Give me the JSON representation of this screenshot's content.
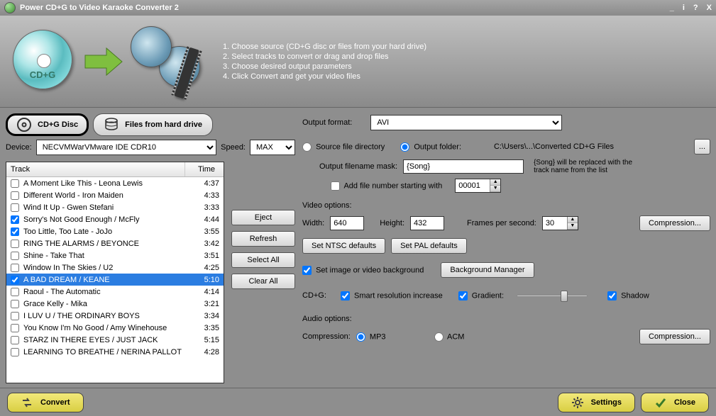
{
  "title": "Power CD+G to Video Karaoke Converter 2",
  "titlebar_icons": {
    "minimize": "_",
    "info": "i",
    "help": "?",
    "close": "X"
  },
  "disc_label": "CD+G",
  "instructions": [
    "1. Choose source (CD+G disc or files from your hard drive)",
    "2. Select tracks to convert or drag and drop files",
    "3. Choose desired output parameters",
    "4. Click Convert and get your video files"
  ],
  "source_buttons": {
    "disc": "CD+G Disc",
    "files": "Files from hard drive"
  },
  "device_label": "Device:",
  "device_value": "NECVMWarVMware IDE CDR10",
  "speed_label": "Speed:",
  "speed_value": "MAX",
  "columns": {
    "track": "Track",
    "time": "Time"
  },
  "tracks": [
    {
      "name": "A Moment Like This - Leona Lewis",
      "time": "4:37",
      "chk": false,
      "sel": false
    },
    {
      "name": "Different World - Iron Maiden",
      "time": "4:33",
      "chk": false,
      "sel": false
    },
    {
      "name": "Wind It Up - Gwen Stefani",
      "time": "3:33",
      "chk": false,
      "sel": false
    },
    {
      "name": "Sorry's Not Good Enough / McFly",
      "time": "4:44",
      "chk": true,
      "sel": false
    },
    {
      "name": "Too Little, Too Late - JoJo",
      "time": "3:55",
      "chk": true,
      "sel": false
    },
    {
      "name": "RING THE ALARMS / BEYONCE",
      "time": "3:42",
      "chk": false,
      "sel": false
    },
    {
      "name": "Shine - Take That",
      "time": "3:51",
      "chk": false,
      "sel": false
    },
    {
      "name": "Window In The Skies / U2",
      "time": "4:25",
      "chk": false,
      "sel": false
    },
    {
      "name": "A BAD DREAM / KEANE",
      "time": "5:10",
      "chk": true,
      "sel": true
    },
    {
      "name": "Raoul - The Automatic",
      "time": "4:14",
      "chk": false,
      "sel": false
    },
    {
      "name": "Grace Kelly - Mika",
      "time": "3:21",
      "chk": false,
      "sel": false
    },
    {
      "name": "I LUV U / THE ORDINARY BOYS",
      "time": "3:34",
      "chk": false,
      "sel": false
    },
    {
      "name": "You Know I'm No Good / Amy Winehouse",
      "time": "3:35",
      "chk": false,
      "sel": false
    },
    {
      "name": "STARZ IN THERE EYES / JUST JACK",
      "time": "5:15",
      "chk": false,
      "sel": false
    },
    {
      "name": "LEARNING TO BREATHE / NERINA PALLOT",
      "time": "4:28",
      "chk": false,
      "sel": false
    }
  ],
  "mid_buttons": {
    "eject": "Eject",
    "refresh": "Refresh",
    "selectall": "Select All",
    "clearall": "Clear All"
  },
  "output": {
    "format_label": "Output format:",
    "format_value": "AVI",
    "src_dir": "Source file directory",
    "out_folder": "Output folder:",
    "out_path": "C:\\Users\\...\\Converted CD+G Files",
    "browse": "...",
    "mask_label": "Output filename mask:",
    "mask_value": "{Song}",
    "mask_hint": "{Song} will be replaced with the track name from the list",
    "addnum_label": "Add file number starting with",
    "addnum_value": "00001"
  },
  "video": {
    "section": "Video options:",
    "width_label": "Width:",
    "width": "640",
    "height_label": "Height:",
    "height": "432",
    "fps_label": "Frames per second:",
    "fps": "30",
    "compression": "Compression...",
    "ntsc": "Set NTSC defaults",
    "pal": "Set PAL defaults",
    "setbg": "Set image or video background",
    "bgmgr": "Background Manager",
    "cdg_label": "CD+G:",
    "sri": "Smart resolution increase",
    "gradient": "Gradient:",
    "shadow": "Shadow"
  },
  "audio": {
    "section": "Audio options:",
    "comp_label": "Compression:",
    "mp3": "MP3",
    "acm": "ACM",
    "compression": "Compression..."
  },
  "footer": {
    "convert": "Convert",
    "settings": "Settings",
    "close": "Close"
  }
}
